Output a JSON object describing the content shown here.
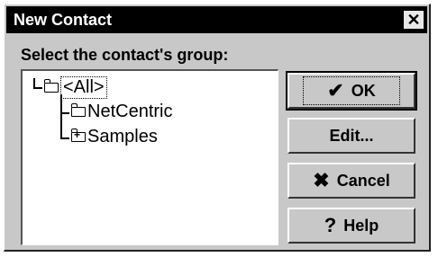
{
  "window": {
    "title": "New Contact",
    "close_glyph": "✕"
  },
  "prompt": "Select the contact's group:",
  "tree": {
    "root": {
      "label": "<All>",
      "icon": "open-folder-icon"
    },
    "children": [
      {
        "label": "NetCentric",
        "icon": "folder-icon"
      },
      {
        "label": "Samples",
        "icon": "folder-plus-icon"
      }
    ]
  },
  "buttons": {
    "ok": {
      "label": "OK",
      "icon": "checkmark-icon",
      "icon_glyph": "✔"
    },
    "edit": {
      "label": "Edit..."
    },
    "cancel": {
      "label": "Cancel",
      "icon": "x-icon",
      "icon_glyph": "✖"
    },
    "help": {
      "label": "Help",
      "icon": "question-icon",
      "icon_glyph": "?"
    }
  }
}
